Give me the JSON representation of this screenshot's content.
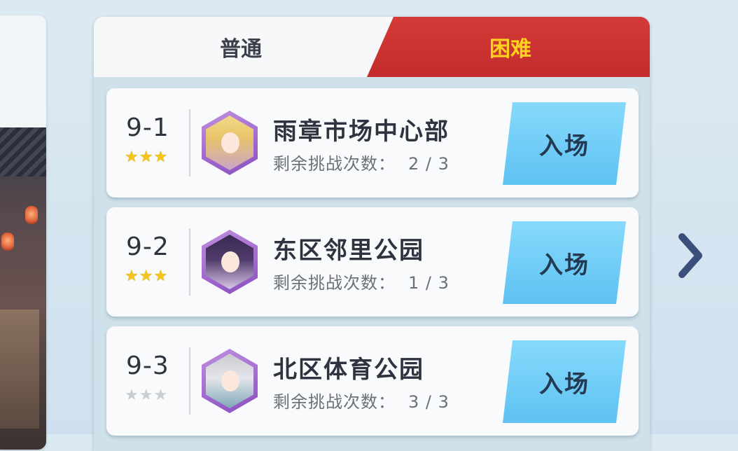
{
  "tabs": {
    "normal": "普通",
    "hard": "困难"
  },
  "stages": [
    {
      "number": "9-1",
      "title": "雨章市场中心部",
      "remaining_label": "剩余挑战次数：",
      "remaining_value": "2 / 3",
      "stars_earned": 3,
      "enter_label": "入场"
    },
    {
      "number": "9-2",
      "title": "东区邻里公园",
      "remaining_label": "剩余挑战次数：",
      "remaining_value": "1 / 3",
      "stars_earned": 3,
      "enter_label": "入场"
    },
    {
      "number": "9-3",
      "title": "北区体育公园",
      "remaining_label": "剩余挑战次数：",
      "remaining_value": "3 / 3",
      "stars_earned": 0,
      "enter_label": "入场"
    }
  ],
  "colors": {
    "hard_tab": "#c93230",
    "hard_text": "#ffd21f",
    "enter_button": "#6fcbf6",
    "star_filled": "#f4c419",
    "star_empty": "#c9cdd2"
  },
  "icons": {
    "next": "chevron-right-icon",
    "star": "star-icon"
  }
}
